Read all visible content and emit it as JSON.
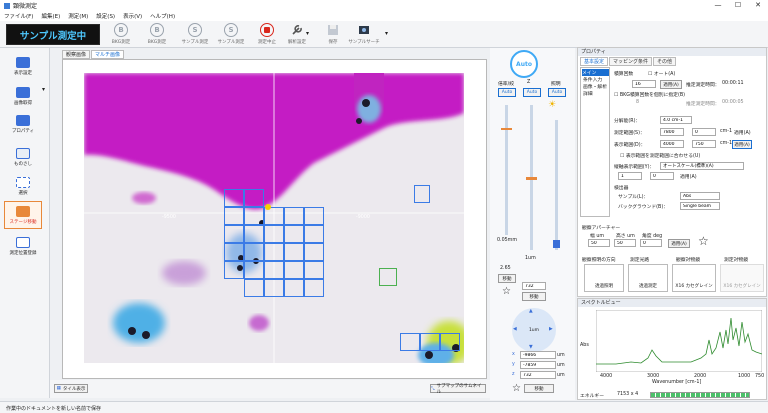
{
  "window": {
    "title": "顕微測定",
    "controls": [
      "—",
      "☐",
      "✕"
    ]
  },
  "menu": [
    "ファイル(F)",
    "編集(E)",
    "測定(M)",
    "設定(S)",
    "表示(V)",
    "ヘルプ(H)"
  ],
  "status": "サンプル測定中",
  "toolbar": [
    {
      "label": "BKG測定",
      "glyph": "B"
    },
    {
      "label": "BKG測定",
      "glyph": "B"
    },
    {
      "label": "サンプル測定",
      "glyph": "S"
    },
    {
      "label": "サンプル測定",
      "glyph": "S"
    },
    {
      "label": "測定中止",
      "glyph": ""
    },
    {
      "label": "解析設定",
      "glyph": ""
    },
    {
      "label": "保存",
      "glyph": ""
    },
    {
      "label": "サンプルサーチ",
      "glyph": ""
    }
  ],
  "sidebar": [
    "表示設定",
    "画像取得",
    "プロパティ",
    "ものさし",
    "選択",
    "ステージ移動",
    "測定位置登録"
  ],
  "viewer": {
    "tabs": [
      "観察画像",
      "マルチ画像"
    ],
    "coords": {
      "left": "-9500",
      "right": "-9000",
      "a1": "-9000",
      "b1": "-9000"
    },
    "bottom_buttons": [
      "タイル表示",
      "サブマップのサムネイル"
    ]
  },
  "control_panel": {
    "auto": "Auto",
    "headers": [
      "倍率/絞",
      "Z",
      "照明"
    ],
    "zoom_value": "0.05mm",
    "z_value": "1um",
    "z_step": "2.65",
    "move_label": "移動",
    "z_pos": "732",
    "step_label": "1um",
    "coords": {
      "x": "-9866",
      "y": "-7859",
      "z": "732",
      "unit": "um"
    }
  },
  "properties": {
    "title": "プロパティ",
    "tabs": [
      "基本設定",
      "マッピング条件",
      "その他"
    ],
    "list": [
      "メイン",
      "条件入力",
      "画像・解析",
      "詳細"
    ],
    "fields": {
      "scan_label": "積算回数",
      "scan_auto": "オート(A)",
      "scans": "16",
      "apply": "適用(A)",
      "est_time_label": "推定測定時間：",
      "est_time": "00:00:11",
      "bkg_option": "BKG積算回数を個別に指定(B)",
      "bkg_scans": "8",
      "bkg_est_label": "推定測定時間：",
      "bkg_est": "00:00:05",
      "resolution_label": "分解能(R)：",
      "resolution": "4.0 cm-1",
      "range_label": "測定範囲(S)：",
      "range_from": "7800",
      "range_to": "0",
      "display_range_label": "表示範囲(D)：",
      "display_from": "4000",
      "display_to": "750",
      "unit": "cm-1",
      "range_note": "表示範囲を測定範囲に合わせる(U)",
      "xaxis_label": "縦軸表示範囲(Y)：",
      "xaxis_value": "オートスケール(標準)(A)",
      "y_from": "1",
      "y_to": "0",
      "detector_label": "検出器",
      "sample_label": "サンプル(L)：",
      "sample_value": "Abs",
      "background_label": "バックグラウンド(B)：",
      "background_value": "Single beam"
    },
    "aperture": {
      "title": "観察アパーチャー",
      "labels": [
        "幅 um",
        "高さ um",
        "角度 deg"
      ],
      "values": [
        "50",
        "50",
        "0"
      ],
      "apply": "適用(A)"
    },
    "illum": {
      "headers": [
        "観察照明の方向",
        "測定光路",
        "観察対物鏡",
        "測定対物鏡"
      ],
      "buttons": [
        "透過照明",
        "透過測定",
        "X16 カセグレイン",
        "X16 カセグレイン"
      ]
    }
  },
  "spectrum": {
    "title": "スペクトルビュー",
    "ylabel": "Abs",
    "xlabel": "Wavenumber [cm-1]",
    "xticks": [
      "4000",
      "3000",
      "2000",
      "1000",
      "750"
    ],
    "status": [
      "エネルギー",
      "7153 x 4"
    ]
  },
  "statusbar": "作業中のドキュメントを新しい名前で保存",
  "colors": {
    "accent": "#1a6fd1",
    "status_text": "#4ec8ff",
    "spectrum": "#2e8b2e",
    "stage_grid": "#3b7be6"
  }
}
